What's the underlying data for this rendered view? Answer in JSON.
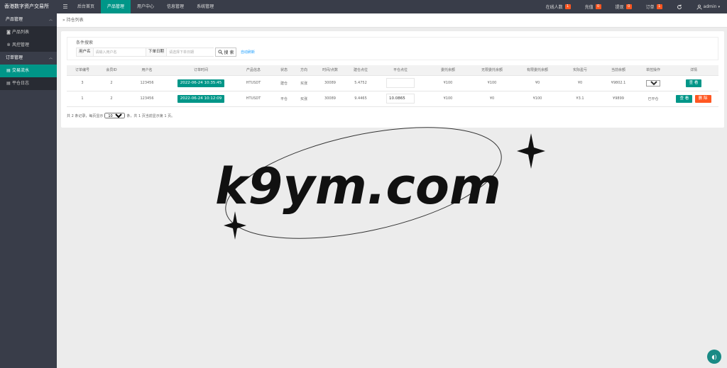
{
  "app": {
    "title": "香港数字资产交易所"
  },
  "topnav": {
    "items": [
      {
        "label": "后台首页",
        "active": false
      },
      {
        "label": "产品管理",
        "active": true
      },
      {
        "label": "用户中心",
        "active": false
      },
      {
        "label": "信息管理",
        "active": false
      },
      {
        "label": "系统管理",
        "active": false
      }
    ],
    "right": [
      {
        "label": "在线人数",
        "badge": "1"
      },
      {
        "label": "充值",
        "badge": "0"
      },
      {
        "label": "提现",
        "badge": "0"
      },
      {
        "label": "订单",
        "badge": "1"
      }
    ],
    "user": "admin",
    "icons": {
      "menu": "menu-icon",
      "refresh": "refresh-icon",
      "user": "user-icon"
    }
  },
  "sidebar": {
    "groups": [
      {
        "title": "产品管理",
        "items": [
          {
            "label": "产品列表",
            "icon": "box-icon",
            "active": false
          },
          {
            "label": "风控管理",
            "icon": "gear-icon",
            "active": false
          }
        ]
      },
      {
        "title": "订单管理",
        "items": [
          {
            "label": "交易流水",
            "icon": "doc-icon",
            "active": true
          },
          {
            "label": "平仓日志",
            "icon": "doc-icon",
            "active": false
          }
        ]
      }
    ]
  },
  "breadcrumb": "持仓列表",
  "filter": {
    "title": "条件搜索",
    "user_label": "用户名",
    "user_placeholder": "请输入用户名",
    "date_label": "下单日期",
    "date_placeholder": "请选择下单日期",
    "search_label": "搜 索",
    "auto_refresh": "自动刷新"
  },
  "table": {
    "headers": [
      "订单编号",
      "会员ID",
      "用户名",
      "订单时间",
      "产品信息",
      "状态",
      "方向",
      "时间/点数",
      "建仓点位",
      "平仓点位",
      "委托余额",
      "无限委托余额",
      "有限委托余额",
      "实际盈亏",
      "当前余额",
      "单控操作",
      "详情"
    ],
    "rows": [
      {
        "id": "3",
        "member_id": "2",
        "username": "123456",
        "time": "2022-06-24 10:35:45",
        "product": "HTUSDT",
        "status": "建仓",
        "direction": "买涨",
        "points": "30089",
        "open": "5.4752",
        "close": "",
        "balance": "¥100",
        "unlimited": "¥100",
        "limited": "¥0",
        "pnl": "¥0",
        "current": "¥9802.1",
        "control": "默认",
        "actions": [
          "查 看"
        ]
      },
      {
        "id": "1",
        "member_id": "2",
        "username": "123456",
        "time": "2022-06-24 10:12:09",
        "product": "HTUSDT",
        "status": "平仓",
        "direction": "买涨",
        "points": "30089",
        "open": "9.4465",
        "close": "10.0865",
        "balance": "¥100",
        "unlimited": "¥0",
        "limited": "¥100",
        "pnl": "¥3.1",
        "current": "¥9899",
        "control": "已平仓",
        "actions": [
          "查 看",
          "删 除"
        ]
      }
    ]
  },
  "pager": {
    "prefix": "共 2 条记录，每页显示",
    "page_size": "10",
    "suffix": "条，共 1 页当前显示第 1 页。"
  },
  "watermark": {
    "text": "k9ym.com"
  },
  "colors": {
    "accent": "#009688",
    "header": "#393d49",
    "danger": "#ff5722",
    "price_red": "#ff2e2e",
    "price_green": "#1ab01a"
  }
}
